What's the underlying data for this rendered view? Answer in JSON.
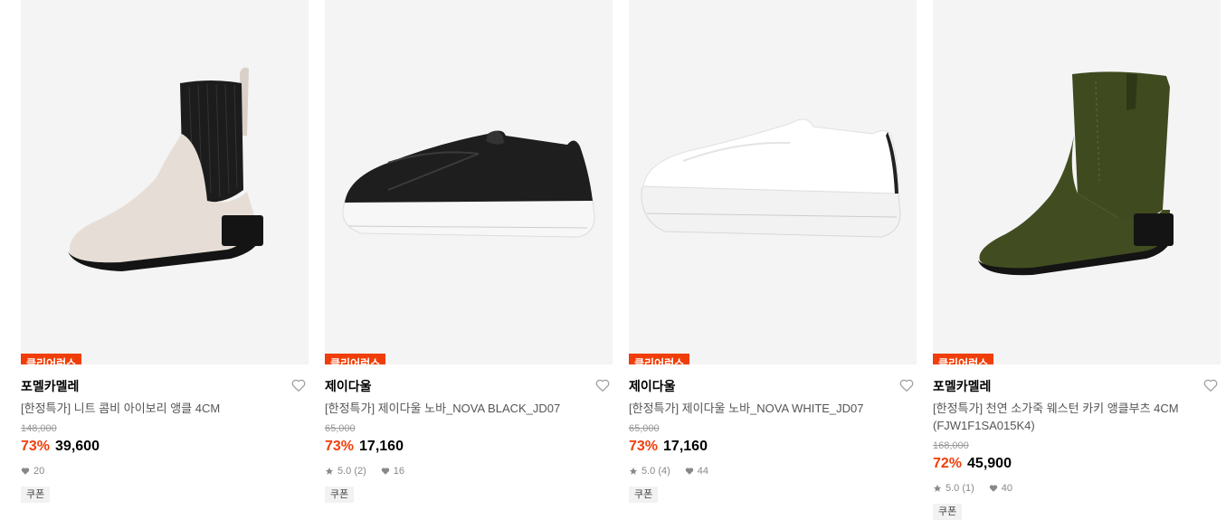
{
  "products": [
    {
      "tag": "클리어런스",
      "brand": "포멜카멜레",
      "name": "[한정특가] 니트 콤비 아이보리 앵클 4CM",
      "original_price": "148,000",
      "discount": "73%",
      "price": "39,600",
      "rating": "",
      "likes": "20",
      "coupon": "쿠폰",
      "image_icon": "ivory-knit-chelsea-boot"
    },
    {
      "tag": "클리어런스",
      "brand": "제이다울",
      "name": "[한정특가] 제이다울 노바_NOVA BLACK_JD07",
      "original_price": "65,000",
      "discount": "73%",
      "price": "17,160",
      "rating": "5.0 (2)",
      "likes": "16",
      "coupon": "쿠폰",
      "image_icon": "black-slip-on-sneaker"
    },
    {
      "tag": "클리어런스",
      "brand": "제이다울",
      "name": "[한정특가] 제이다울 노바_NOVA WHITE_JD07",
      "original_price": "65,000",
      "discount": "73%",
      "price": "17,160",
      "rating": "5.0 (4)",
      "likes": "44",
      "coupon": "쿠폰",
      "image_icon": "white-slip-on-sneaker"
    },
    {
      "tag": "클리어런스",
      "brand": "포멜카멜레",
      "name": "[한정특가] 천연 소가죽 웨스턴 카키 앵클부츠 4CM (FJW1F1SA015K4)",
      "original_price": "168,000",
      "discount": "72%",
      "price": "45,900",
      "rating": "5.0 (1)",
      "likes": "40",
      "coupon": "쿠폰",
      "image_icon": "khaki-suede-western-boot"
    }
  ],
  "colors": {
    "accent": "#f03e0a",
    "image_bg": "#f4f4f4"
  }
}
